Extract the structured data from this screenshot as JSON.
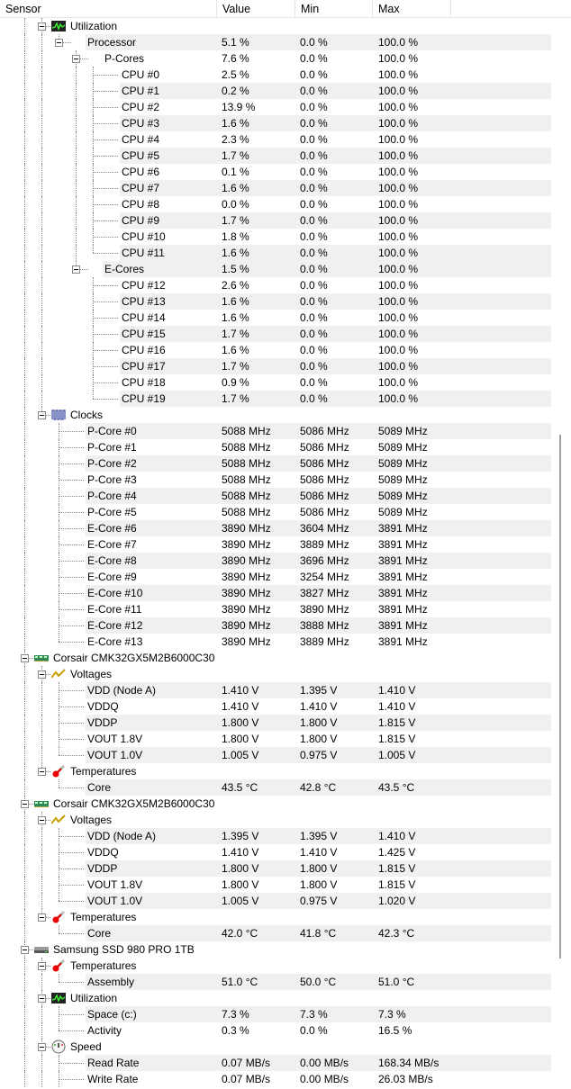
{
  "header": {
    "sensor": "Sensor",
    "value": "Value",
    "min": "Min",
    "max": "Max"
  },
  "rows": [
    [
      1,
      "Utilization",
      "",
      "",
      "",
      "util",
      0
    ],
    [
      2,
      "Processor",
      "5.1 %",
      "0.0 %",
      "100.0 %",
      "",
      1
    ],
    [
      3,
      "P-Cores",
      "7.6 %",
      "0.0 %",
      "100.0 %",
      "",
      0
    ],
    [
      4,
      "CPU #0",
      "2.5 %",
      "0.0 %",
      "100.0 %",
      "",
      0
    ],
    [
      4,
      "CPU #1",
      "0.2 %",
      "0.0 %",
      "100.0 %",
      "",
      1
    ],
    [
      4,
      "CPU #2",
      "13.9 %",
      "0.0 %",
      "100.0 %",
      "",
      0
    ],
    [
      4,
      "CPU #3",
      "1.6 %",
      "0.0 %",
      "100.0 %",
      "",
      1
    ],
    [
      4,
      "CPU #4",
      "2.3 %",
      "0.0 %",
      "100.0 %",
      "",
      0
    ],
    [
      4,
      "CPU #5",
      "1.7 %",
      "0.0 %",
      "100.0 %",
      "",
      1
    ],
    [
      4,
      "CPU #6",
      "0.1 %",
      "0.0 %",
      "100.0 %",
      "",
      0
    ],
    [
      4,
      "CPU #7",
      "1.6 %",
      "0.0 %",
      "100.0 %",
      "",
      1
    ],
    [
      4,
      "CPU #8",
      "0.0 %",
      "0.0 %",
      "100.0 %",
      "",
      0
    ],
    [
      4,
      "CPU #9",
      "1.7 %",
      "0.0 %",
      "100.0 %",
      "",
      1
    ],
    [
      4,
      "CPU #10",
      "1.8 %",
      "0.0 %",
      "100.0 %",
      "",
      0
    ],
    [
      4,
      "CPU #11",
      "1.6 %",
      "0.0 %",
      "100.0 %",
      "",
      1
    ],
    [
      3,
      "E-Cores",
      "1.5 %",
      "0.0 %",
      "100.0 %",
      "",
      1
    ],
    [
      4,
      "CPU #12",
      "2.6 %",
      "0.0 %",
      "100.0 %",
      "",
      0
    ],
    [
      4,
      "CPU #13",
      "1.6 %",
      "0.0 %",
      "100.0 %",
      "",
      1
    ],
    [
      4,
      "CPU #14",
      "1.6 %",
      "0.0 %",
      "100.0 %",
      "",
      0
    ],
    [
      4,
      "CPU #15",
      "1.7 %",
      "0.0 %",
      "100.0 %",
      "",
      1
    ],
    [
      4,
      "CPU #16",
      "1.6 %",
      "0.0 %",
      "100.0 %",
      "",
      0
    ],
    [
      4,
      "CPU #17",
      "1.7 %",
      "0.0 %",
      "100.0 %",
      "",
      1
    ],
    [
      4,
      "CPU #18",
      "0.9 %",
      "0.0 %",
      "100.0 %",
      "",
      0
    ],
    [
      4,
      "CPU #19",
      "1.7 %",
      "0.0 %",
      "100.0 %",
      "",
      1
    ],
    [
      1,
      "Clocks",
      "",
      "",
      "",
      "clock",
      0
    ],
    [
      2,
      "P-Core #0",
      "5088 MHz",
      "5086 MHz",
      "5089 MHz",
      "",
      1
    ],
    [
      2,
      "P-Core #1",
      "5088 MHz",
      "5086 MHz",
      "5089 MHz",
      "",
      0
    ],
    [
      2,
      "P-Core #2",
      "5088 MHz",
      "5086 MHz",
      "5089 MHz",
      "",
      1
    ],
    [
      2,
      "P-Core #3",
      "5088 MHz",
      "5086 MHz",
      "5089 MHz",
      "",
      0
    ],
    [
      2,
      "P-Core #4",
      "5088 MHz",
      "5086 MHz",
      "5089 MHz",
      "",
      1
    ],
    [
      2,
      "P-Core #5",
      "5088 MHz",
      "5086 MHz",
      "5089 MHz",
      "",
      0
    ],
    [
      2,
      "E-Core #6",
      "3890 MHz",
      "3604 MHz",
      "3891 MHz",
      "",
      1
    ],
    [
      2,
      "E-Core #7",
      "3890 MHz",
      "3889 MHz",
      "3891 MHz",
      "",
      0
    ],
    [
      2,
      "E-Core #8",
      "3890 MHz",
      "3696 MHz",
      "3891 MHz",
      "",
      1
    ],
    [
      2,
      "E-Core #9",
      "3890 MHz",
      "3254 MHz",
      "3891 MHz",
      "",
      0
    ],
    [
      2,
      "E-Core #10",
      "3890 MHz",
      "3827 MHz",
      "3891 MHz",
      "",
      1
    ],
    [
      2,
      "E-Core #11",
      "3890 MHz",
      "3890 MHz",
      "3891 MHz",
      "",
      0
    ],
    [
      2,
      "E-Core #12",
      "3890 MHz",
      "3888 MHz",
      "3891 MHz",
      "",
      1
    ],
    [
      2,
      "E-Core #13",
      "3890 MHz",
      "3889 MHz",
      "3891 MHz",
      "",
      0
    ],
    [
      0,
      "Corsair CMK32GX5M2B6000C30",
      "",
      "",
      "",
      "ram",
      0
    ],
    [
      1,
      "Voltages",
      "",
      "",
      "",
      "volt",
      0
    ],
    [
      2,
      "VDD (Node A)",
      "1.410 V",
      "1.395 V",
      "1.410 V",
      "",
      1
    ],
    [
      2,
      "VDDQ",
      "1.410 V",
      "1.410 V",
      "1.410 V",
      "",
      0
    ],
    [
      2,
      "VDDP",
      "1.800 V",
      "1.800 V",
      "1.815 V",
      "",
      1
    ],
    [
      2,
      "VOUT 1.8V",
      "1.800 V",
      "1.800 V",
      "1.815 V",
      "",
      0
    ],
    [
      2,
      "VOUT 1.0V",
      "1.005 V",
      "0.975 V",
      "1.005 V",
      "",
      1
    ],
    [
      1,
      "Temperatures",
      "",
      "",
      "",
      "temp",
      0
    ],
    [
      2,
      "Core",
      "43.5 °C",
      "42.8 °C",
      "43.5 °C",
      "",
      1
    ],
    [
      0,
      "Corsair CMK32GX5M2B6000C30",
      "",
      "",
      "",
      "ram",
      0
    ],
    [
      1,
      "Voltages",
      "",
      "",
      "",
      "volt",
      0
    ],
    [
      2,
      "VDD (Node A)",
      "1.395 V",
      "1.395 V",
      "1.410 V",
      "",
      1
    ],
    [
      2,
      "VDDQ",
      "1.410 V",
      "1.410 V",
      "1.425 V",
      "",
      0
    ],
    [
      2,
      "VDDP",
      "1.800 V",
      "1.800 V",
      "1.815 V",
      "",
      1
    ],
    [
      2,
      "VOUT 1.8V",
      "1.800 V",
      "1.800 V",
      "1.815 V",
      "",
      0
    ],
    [
      2,
      "VOUT 1.0V",
      "1.005 V",
      "0.975 V",
      "1.020 V",
      "",
      1
    ],
    [
      1,
      "Temperatures",
      "",
      "",
      "",
      "temp",
      0
    ],
    [
      2,
      "Core",
      "42.0 °C",
      "41.8 °C",
      "42.3 °C",
      "",
      1
    ],
    [
      0,
      "Samsung SSD 980 PRO 1TB",
      "",
      "",
      "",
      "drive",
      0
    ],
    [
      1,
      "Temperatures",
      "",
      "",
      "",
      "temp",
      0
    ],
    [
      2,
      "Assembly",
      "51.0 °C",
      "50.0 °C",
      "51.0 °C",
      "",
      1
    ],
    [
      1,
      "Utilization",
      "",
      "",
      "",
      "util",
      0
    ],
    [
      2,
      "Space (c:)",
      "7.3 %",
      "7.3 %",
      "7.3 %",
      "",
      1
    ],
    [
      2,
      "Activity",
      "0.3 %",
      "0.0 %",
      "16.5 %",
      "",
      0
    ],
    [
      1,
      "Speed",
      "",
      "",
      "",
      "speed",
      0
    ],
    [
      2,
      "Read Rate",
      "0.07 MB/s",
      "0.00 MB/s",
      "168.34 MB/s",
      "",
      1
    ],
    [
      2,
      "Write Rate",
      "0.07 MB/s",
      "0.00 MB/s",
      "26.03 MB/s",
      "",
      0
    ]
  ]
}
